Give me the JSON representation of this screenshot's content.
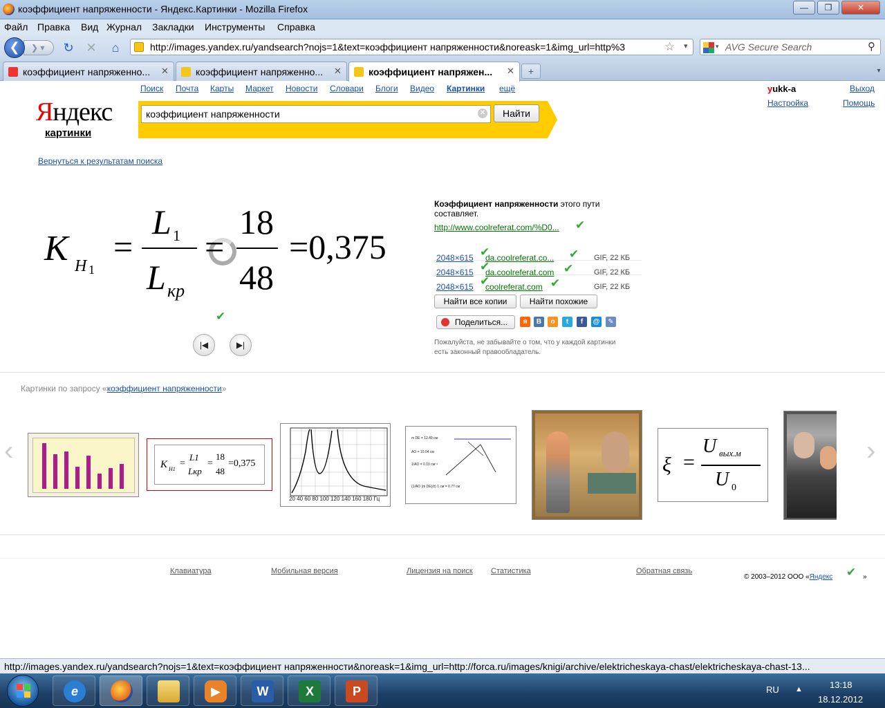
{
  "window": {
    "title": "коэффициент напряженности - Яндекс.Картинки - Mozilla Firefox",
    "min": "—",
    "max": "❐",
    "close": "✕"
  },
  "menu": [
    "Файл",
    "Правка",
    "Вид",
    "Журнал",
    "Закладки",
    "Инструменты",
    "Справка"
  ],
  "nav": {
    "back": "❮",
    "forward": "❯ ▾",
    "reload": "↻",
    "stop": "✕",
    "home": "⌂",
    "url": "http://images.yandex.ru/yandsearch?nojs=1&text=коэффициент напряженности&noreask=1&img_url=http%3",
    "star": "☆",
    "dropdown": "▾",
    "search_placeholder": "AVG Secure Search",
    "search_icon": "⚲"
  },
  "tabs": [
    {
      "label": "коэффициент напряженно...",
      "close": "✕",
      "icon_color": "#e33"
    },
    {
      "label": "коэффициент напряженно...",
      "close": "✕",
      "icon_color": "#f5c518"
    },
    {
      "label": "коэффициент напряжен...",
      "close": "✕",
      "icon_color": "#f5c518",
      "active": true
    }
  ],
  "newtab": "+",
  "tabscroll": "▾",
  "services": [
    "Поиск",
    "Почта",
    "Карты",
    "Маркет",
    "Новости",
    "Словари",
    "Блоги",
    "Видео",
    "Картинки",
    "ещё"
  ],
  "logo": {
    "y": "Я",
    "rest": "ндекс",
    "sub": "картинки"
  },
  "search": {
    "query": "коэффициент напряженности",
    "clear": "✕",
    "button": "Найти"
  },
  "user": {
    "first": "y",
    "rest": "ukk-a",
    "settings": "Настройка",
    "logout": "Выход",
    "help": "Помощь"
  },
  "back_link": "Вернуться к результатам поиска",
  "formula": {
    "K": "K",
    "H": "H",
    "one": "1",
    "eq": "=",
    "L": "L",
    "L1": "1",
    "kp": "кр",
    "n18": "18",
    "n48": "48",
    "result": "=0,375"
  },
  "viewer": {
    "prev": "|◀",
    "next": "▶|"
  },
  "info": {
    "title_bold": "Коэффициент напряженности",
    "title_rest": "этого пути",
    "line2": "составляет.",
    "source_link": "http://www.coolreferat.com/%D0...",
    "copies": [
      {
        "size": "2048×615",
        "site": "da.coolreferat.co...",
        "meta": "GIF, 22 КБ"
      },
      {
        "size": "2048×615",
        "site": "da.coolreferat.com",
        "meta": "GIF, 22 КБ"
      },
      {
        "size": "2048×615",
        "site": "coolreferat.com",
        "meta": "GIF, 22 КБ"
      }
    ],
    "find_all": "Найти все копии",
    "find_similar": "Найти похожие",
    "share": "Поделиться...",
    "notice1": "Пожалуйста, не забывайте о том, что у каждой картинки",
    "notice2": "есть законный правообладатель."
  },
  "related": {
    "prefix": "Картинки по запросу «",
    "query": "коэффициент напряженности",
    "suffix": "»"
  },
  "thumbs": {
    "prev": "‹",
    "next": "›",
    "t2": {
      "K": "K",
      "H1": "H1",
      "eq": "=",
      "L1": "L1",
      "Lkp": "Lкр",
      "n18": "18",
      "n48": "48",
      "res": "=0,375"
    },
    "t3_axis": "20 40 60 80 100 120 140 160 180 Гц",
    "t4": [
      "m DE = 12.49 см",
      "AO = 10.04 см",
      "1/AO = 0.10 см⁻¹",
      "(1/AO (m DE)/z) 1 см = 0.77 см"
    ],
    "t6": {
      "xi": "ξ",
      "eq": "=",
      "num": "U",
      "num_sub": "вых.м",
      "den": "U",
      "den_sub": "0"
    }
  },
  "footer": {
    "links": [
      "Клавиатура",
      "Мобильная версия",
      "Лицензия на поиск",
      "Статистика",
      "Обратная связь"
    ],
    "copyright": "© 2003–2012  ООО «",
    "company": "Яндекс",
    "copyright_end": "»"
  },
  "status": "http://images.yandex.ru/yandsearch?nojs=1&text=коэффициент напряженности&noreask=1&img_url=http://forca.ru/images/knigi/archive/elektricheskaya-chast/elektricheskaya-chast-13...",
  "taskbar": {
    "apps": [
      {
        "name": "ie",
        "glyph": "e",
        "color": "#2a7fd4"
      },
      {
        "name": "firefox",
        "glyph": "",
        "color": "#e86a1a"
      },
      {
        "name": "explorer",
        "glyph": "",
        "color": "#e8c050"
      },
      {
        "name": "media-player",
        "glyph": "▶",
        "color": "#e8832a"
      },
      {
        "name": "word",
        "glyph": "W",
        "color": "#2b5ca8"
      },
      {
        "name": "excel",
        "glyph": "X",
        "color": "#1e7a3a"
      },
      {
        "name": "powerpoint",
        "glyph": "P",
        "color": "#c94a20"
      }
    ],
    "lang": "RU",
    "tray_arrow": "▲",
    "time": "13:18",
    "date": "18.12.2012"
  }
}
